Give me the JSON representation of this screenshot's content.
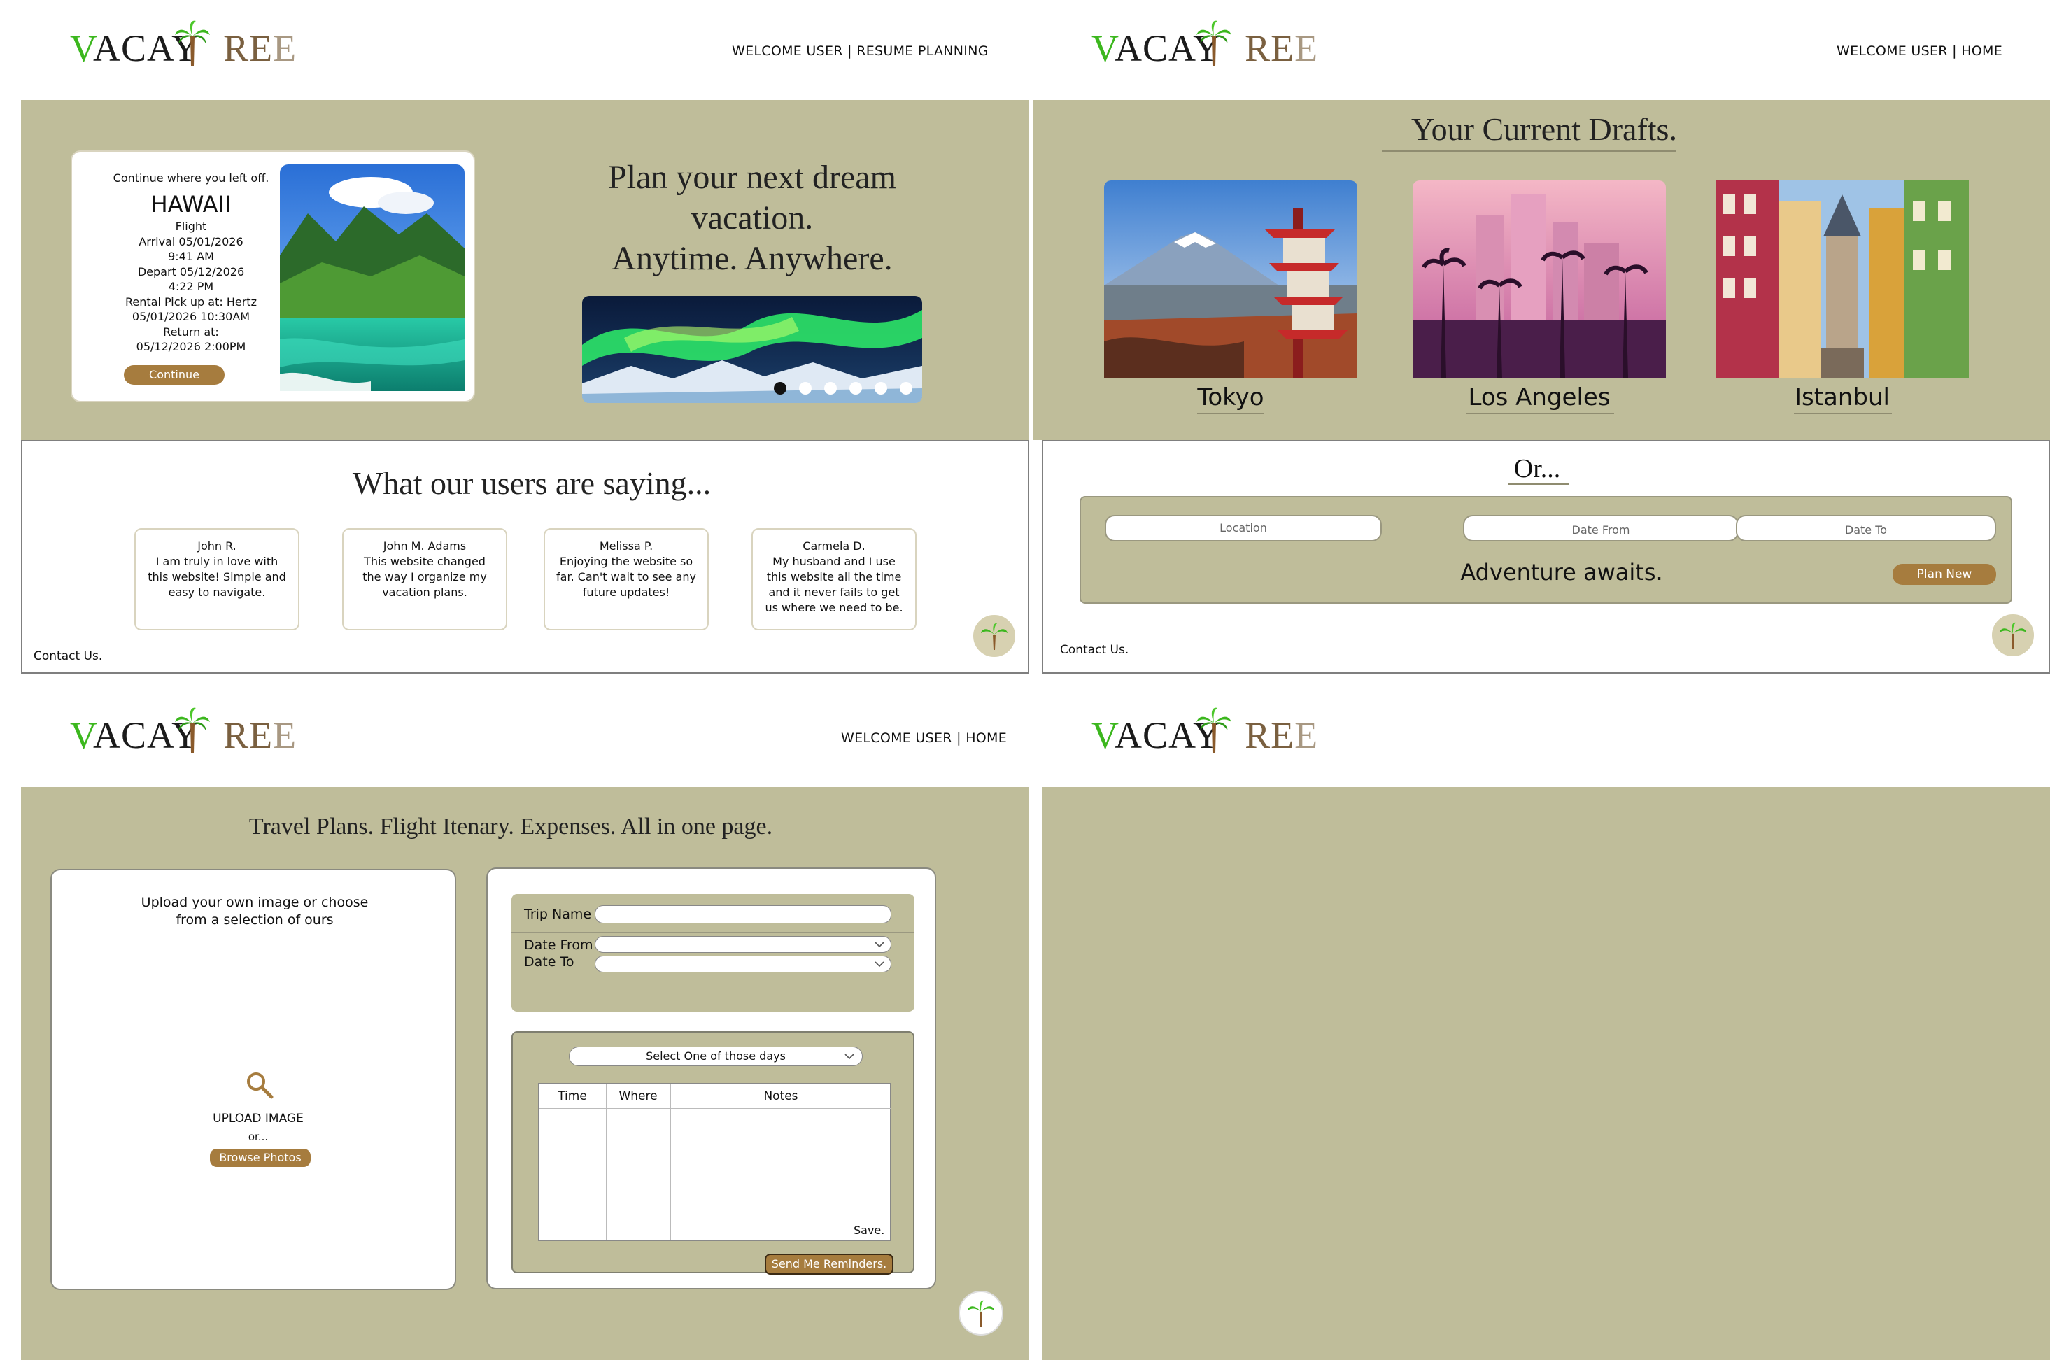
{
  "brand": {
    "logo": "VACAYTREE"
  },
  "panel1": {
    "nav": "WELCOME USER | RESUME PLANNING",
    "resume_card": {
      "heading": "Continue where you left off.",
      "destination": "HAWAII",
      "lines": [
        "Flight",
        "Arrival 05/01/2026",
        "9:41 AM",
        "Depart 05/12/2026",
        "4:22 PM",
        "Rental Pick up at: Hertz",
        "05/01/2026 10:30AM",
        "Return at:",
        "05/12/2026 2:00PM"
      ],
      "button": "Continue"
    },
    "hero": {
      "line1": "Plan your next dream",
      "line2": "vacation.",
      "line3": "Anytime. Anywhere."
    },
    "carousel": {
      "count": 6,
      "active": 0
    },
    "testimonials": {
      "title": "What our users are saying...",
      "items": [
        {
          "name": "John R.",
          "text": "I am truly in love with this website! Simple and easy to navigate."
        },
        {
          "name": "John M. Adams",
          "text": "This website changed the way I organize my vacation plans."
        },
        {
          "name": "Melissa P.",
          "text": "Enjoying the website so far. Can't wait to see any future updates!"
        },
        {
          "name": "Carmela D.",
          "text": "My husband and I use this website all the time and it never fails to get us where we need to be."
        }
      ]
    },
    "contact": "Contact Us."
  },
  "panel2": {
    "nav": "WELCOME USER | HOME",
    "title": "Your Current Drafts.",
    "drafts": [
      "Tokyo",
      "Los Angeles",
      "Istanbul"
    ],
    "or": "Or...",
    "location_placeholder": "Location",
    "date_from_placeholder": "Date From",
    "date_to_placeholder": "Date To",
    "tagline": "Adventure awaits.",
    "plan_button": "Plan New",
    "contact": "Contact Us."
  },
  "panel3": {
    "nav": "WELCOME USER | HOME",
    "title": "Travel Plans. Flight Itenary. Expenses. All in one page.",
    "upload": {
      "prompt": "Upload your own image or choose from a selection of ours",
      "label": "UPLOAD IMAGE",
      "or": "or...",
      "button": "Browse Photos"
    },
    "form": {
      "trip_name_label": "Trip Name",
      "date_from_label": "Date From",
      "date_to_label": "Date To",
      "day_select": "Select One of those days",
      "columns": [
        "Time",
        "Where",
        "Notes"
      ],
      "save": "Save.",
      "reminders_button": "Send Me Reminders."
    }
  },
  "colors": {
    "olive": "#bfbd9a",
    "brown": "#a67c3e",
    "green": "#3cb71e"
  }
}
